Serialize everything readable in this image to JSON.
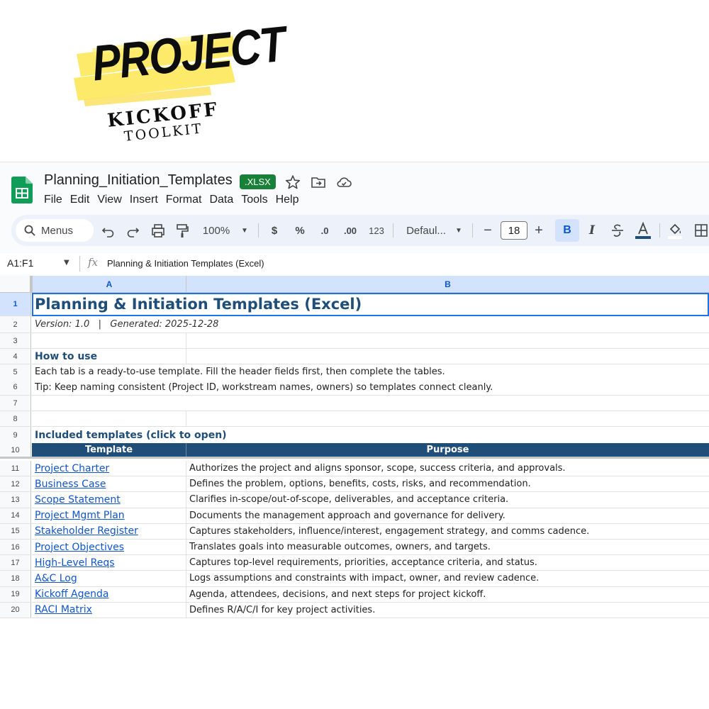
{
  "logo": {
    "line1": "PROJECT",
    "line2": "KICKOFF",
    "line3": "TOOLKIT",
    "accent_color": "#fde96a"
  },
  "window": {
    "doc_title": "Planning_Initiation_Templates",
    "format_badge": ".XLSX",
    "icons": [
      "star-icon",
      "move-to-folder-icon",
      "cloud-saved-icon"
    ],
    "menu": [
      "File",
      "Edit",
      "View",
      "Insert",
      "Format",
      "Data",
      "Tools",
      "Help"
    ]
  },
  "toolbar": {
    "menus_label": "Menus",
    "zoom": "100%",
    "currency": "$",
    "percent": "%",
    "dec_decrease": ".0",
    "dec_increase": ".00",
    "number_format": "123",
    "font": "Defaul...",
    "font_size": "18",
    "bold": "B",
    "italic": "I"
  },
  "formula_bar": {
    "name_box": "A1:F1",
    "fx": "fx",
    "content": "Planning & Initiation Templates (Excel)"
  },
  "grid": {
    "columns": [
      "A",
      "B"
    ],
    "rows": [
      {
        "n": "1",
        "a": "Planning & Initiation Templates (Excel)"
      },
      {
        "n": "2",
        "a": "Version: 1.0   |   Generated: 2025-12-28"
      },
      {
        "n": "3",
        "a": ""
      },
      {
        "n": "4",
        "a": "How to use"
      },
      {
        "n": "5",
        "a": "Each tab is a ready-to-use template. Fill the header fields first, then complete the tables."
      },
      {
        "n": "6",
        "a": "Tip: Keep naming consistent (Project ID, workstream names, owners) so templates connect cleanly."
      },
      {
        "n": "7",
        "a": ""
      },
      {
        "n": "8",
        "a": ""
      },
      {
        "n": "9",
        "a": "Included templates (click to open)"
      },
      {
        "n": "10",
        "a": "Template",
        "b": "Purpose"
      }
    ],
    "templates": [
      {
        "n": "11",
        "name": "Project Charter",
        "purpose": "Authorizes the project and aligns sponsor, scope, success criteria, and approvals."
      },
      {
        "n": "12",
        "name": "Business Case",
        "purpose": "Defines the problem, options, benefits, costs, risks, and recommendation."
      },
      {
        "n": "13",
        "name": "Scope Statement",
        "purpose": "Clarifies in-scope/out-of-scope, deliverables, and acceptance criteria."
      },
      {
        "n": "14",
        "name": "Project Mgmt Plan",
        "purpose": "Documents the management approach and governance for delivery."
      },
      {
        "n": "15",
        "name": "Stakeholder Register",
        "purpose": "Captures stakeholders, influence/interest, engagement strategy, and comms cadence."
      },
      {
        "n": "16",
        "name": "Project Objectives",
        "purpose": "Translates goals into measurable outcomes, owners, and targets."
      },
      {
        "n": "17",
        "name": "High-Level Reqs",
        "purpose": "Captures top-level requirements, priorities, acceptance criteria, and status."
      },
      {
        "n": "18",
        "name": "A&C Log",
        "purpose": "Logs assumptions and constraints with impact, owner, and review cadence."
      },
      {
        "n": "19",
        "name": "Kickoff Agenda",
        "purpose": "Agenda, attendees, decisions, and next steps for project kickoff."
      },
      {
        "n": "20",
        "name": "RACI Matrix",
        "purpose": "Defines R/A/C/I for key project activities."
      }
    ]
  },
  "colors": {
    "header_fill": "#1f4e79",
    "title_text": "#1f4e79",
    "link": "#1155cc",
    "selection": "#d3e3fd",
    "sheets_green": "#188038"
  }
}
